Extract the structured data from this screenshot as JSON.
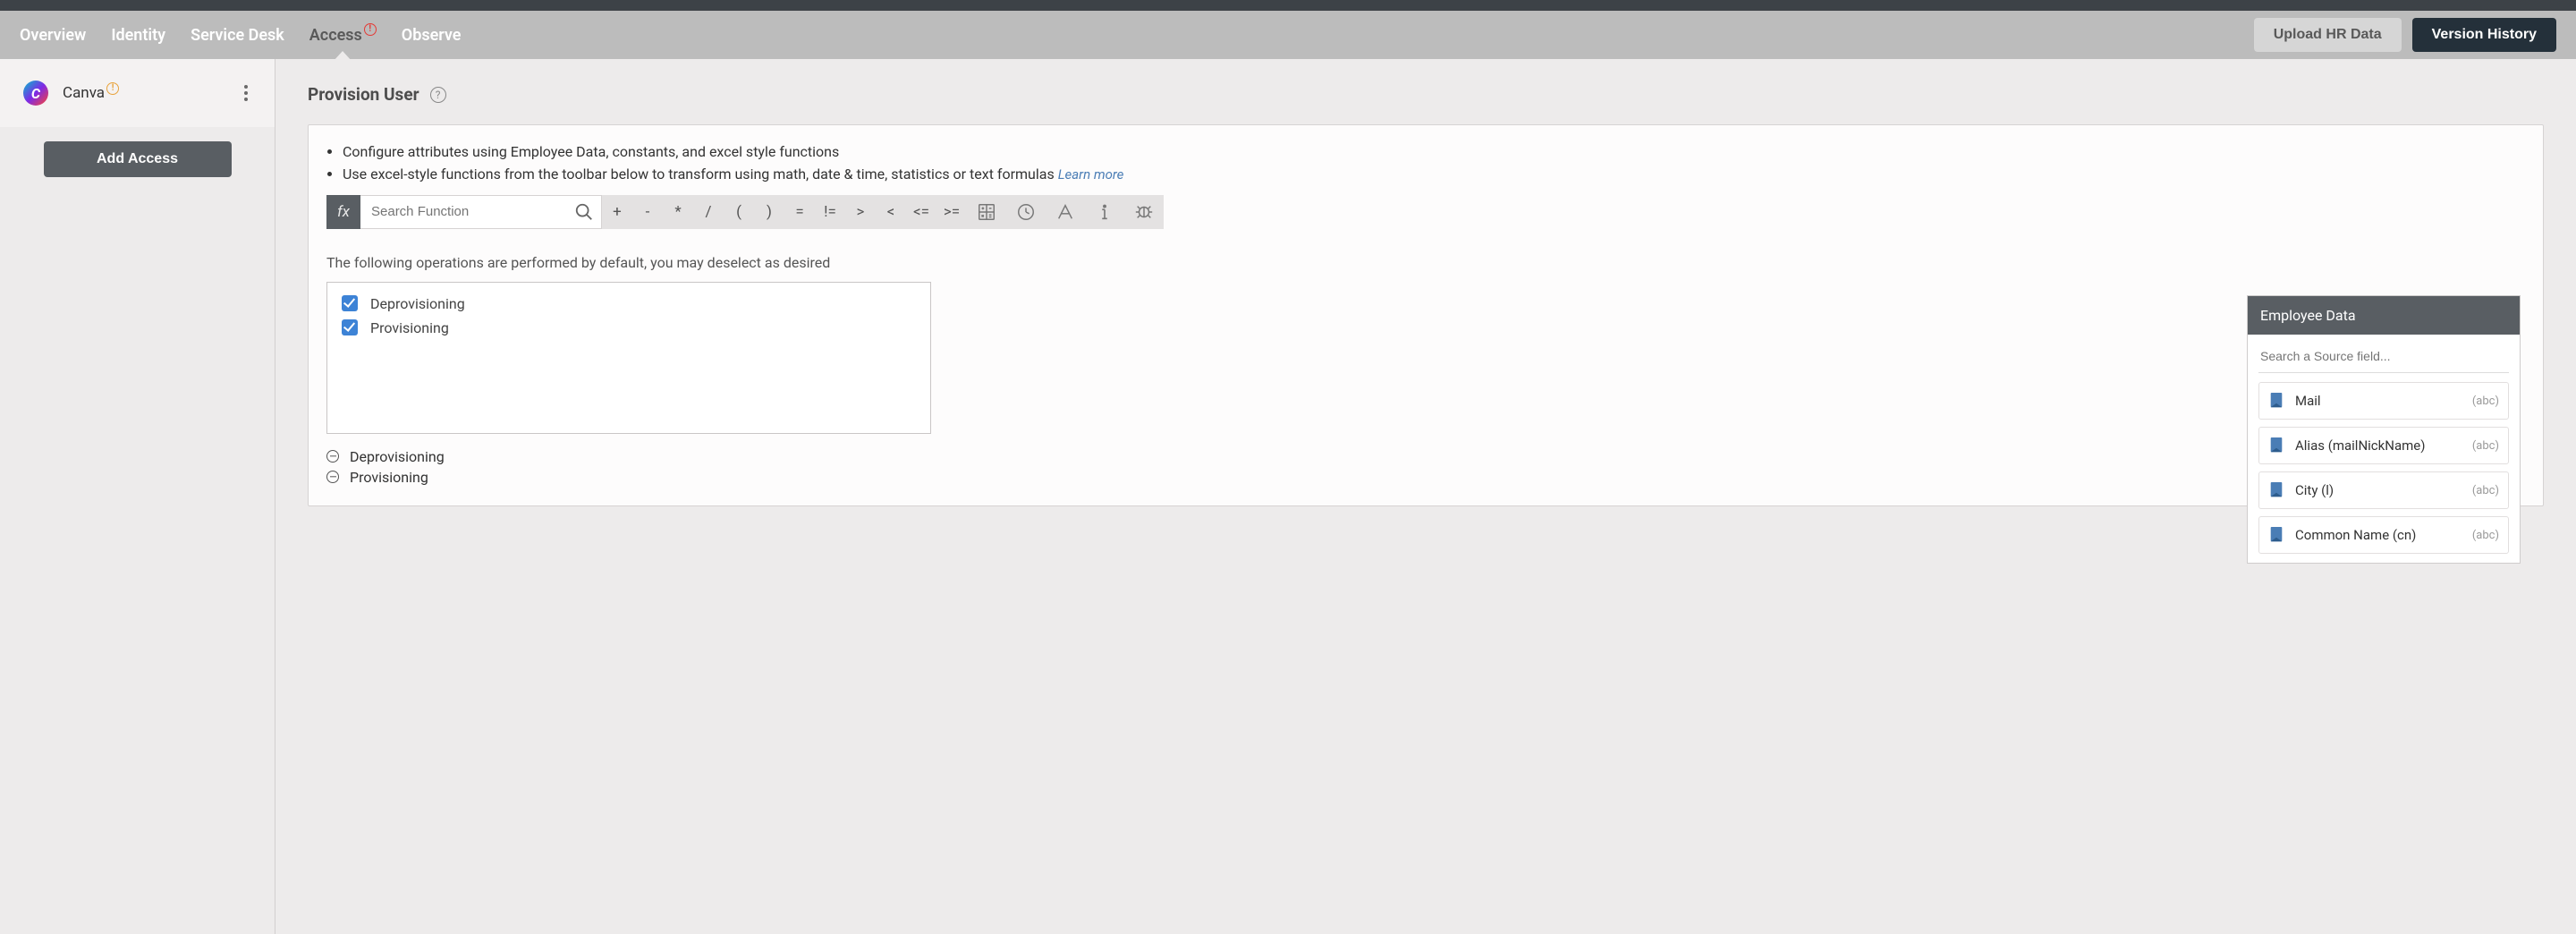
{
  "nav": {
    "items": [
      "Overview",
      "Identity",
      "Service Desk",
      "Access",
      "Observe"
    ],
    "active_index": 3,
    "upload_btn": "Upload HR Data",
    "version_btn": "Version History"
  },
  "sidebar": {
    "app_name": "Canva",
    "logo_letter": "C",
    "add_access_btn": "Add Access"
  },
  "page": {
    "title": "Provision User",
    "bullets": [
      "Configure attributes using Employee Data, constants, and excel style functions",
      "Use excel-style functions from the toolbar below to transform using math, date & time, statistics or text formulas"
    ],
    "learn_more": "Learn more",
    "fx_label": "fx",
    "search_fn_placeholder": "Search Function",
    "operators": [
      "+",
      "-",
      "*",
      "/",
      "(",
      ")",
      "=",
      "!=",
      ">",
      "<",
      "<=",
      ">="
    ],
    "toolbar_icons": [
      "calc-icon",
      "clock-icon",
      "text-icon",
      "info-icon",
      "bug-icon"
    ],
    "ops_hint": "The following operations are performed by default, you may deselect as desired",
    "checks": [
      {
        "label": "Deprovisioning",
        "checked": true
      },
      {
        "label": "Provisioning",
        "checked": true
      }
    ],
    "op_lines": [
      "Deprovisioning",
      "Provisioning"
    ]
  },
  "employee_data": {
    "title": "Employee Data",
    "search_placeholder": "Search a Source field...",
    "fields": [
      {
        "label": "Mail",
        "type": "(abc)"
      },
      {
        "label": "Alias (mailNickName)",
        "type": "(abc)"
      },
      {
        "label": "City (l)",
        "type": "(abc)"
      },
      {
        "label": "Common Name (cn)",
        "type": "(abc)"
      }
    ]
  }
}
